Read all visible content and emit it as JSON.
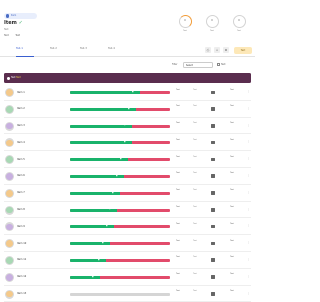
{
  "header": {
    "chip": "Item",
    "title": "Item",
    "title_mark": "✓",
    "subtitle": "Text",
    "meta": [
      "Text",
      "Text"
    ]
  },
  "stats": [
    {
      "value": "0",
      "label": "Text"
    },
    {
      "value": "0",
      "label": "Text"
    },
    {
      "value": "0",
      "label": "Text"
    }
  ],
  "tabs": [
    "Tab 1",
    "Tab 2",
    "Tab 3",
    "Tab 4"
  ],
  "toolbar": {
    "warning_label": "Text"
  },
  "filters": {
    "label": "Filter",
    "select_value": "Select",
    "checkbox_label": "Text"
  },
  "banner": {
    "text": "Text",
    "highlight": "Text"
  },
  "colors": {
    "green": "#19b36b",
    "red": "#e24b6b",
    "banner": "#5a2d4e",
    "accent": "#3a5fcf"
  },
  "rows": [
    {
      "name": "Item 1",
      "fill_percent": 70,
      "s1": "Text",
      "s2": "Text",
      "s3": "Text"
    },
    {
      "name": "Item 2",
      "fill_percent": 66,
      "s1": "Text",
      "s2": "Text",
      "s3": "Text"
    },
    {
      "name": "Item 3",
      "fill_percent": 62,
      "s1": "Text",
      "s2": "Text",
      "s3": "Text"
    },
    {
      "name": "Item 4",
      "fill_percent": 62,
      "s1": "Text",
      "s2": "Text",
      "s3": "Text"
    },
    {
      "name": "Item 5",
      "fill_percent": 58,
      "s1": "Text",
      "s2": "Text",
      "s3": "Text"
    },
    {
      "name": "Item 6",
      "fill_percent": 54,
      "s1": "Text",
      "s2": "Text",
      "s3": "Text"
    },
    {
      "name": "Item 7",
      "fill_percent": 50,
      "s1": "Text",
      "s2": "Text",
      "s3": "Text"
    },
    {
      "name": "Item 8",
      "fill_percent": 47,
      "s1": "Text",
      "s2": "Text",
      "s3": "Text"
    },
    {
      "name": "Item 9",
      "fill_percent": 44,
      "s1": "Text",
      "s2": "Text",
      "s3": "Text"
    },
    {
      "name": "Item 10",
      "fill_percent": 40,
      "s1": "Text",
      "s2": "Text",
      "s3": "Text"
    },
    {
      "name": "Item 11",
      "fill_percent": 36,
      "s1": "Text",
      "s2": "Text",
      "s3": "Text"
    },
    {
      "name": "Item 12",
      "fill_percent": 30,
      "s1": "Text",
      "s2": "Text",
      "s3": "Text"
    },
    {
      "name": "Item 13",
      "fill_percent": 0,
      "s1": "Text",
      "s2": "Text",
      "s3": "Text"
    }
  ]
}
